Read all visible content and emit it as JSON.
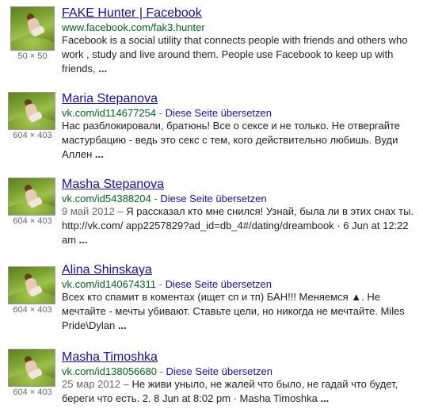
{
  "results": [
    {
      "title": "FAKE Hunter | Facebook",
      "url": "www.facebook.com/fak3.hunter",
      "translate": "",
      "date": "",
      "snippet": "Facebook is a social utility that connects people with friends and others who work , study and live around them. People use Facebook to keep up with friends, ",
      "ellipsis": "...",
      "size": "50 × 50"
    },
    {
      "title": "Maria Stepanova",
      "url": "vk.com/id114677254",
      "separator": " - ",
      "translate": "Diese Seite übersetzen",
      "date": "",
      "snippet": "Нас разблокировали, братюнь! Все о сексе и не только. Не отвергайте мастурбацию - ведь это секс с тем, кого действительно любишь. Вуди Аллен ",
      "ellipsis": "...",
      "size": "604 × 403"
    },
    {
      "title": "Masha Stepanova",
      "url": "vk.com/id54388204",
      "separator": " - ",
      "translate": "Diese Seite übersetzen",
      "date": "9 май 2012 – ",
      "snippet": "Я рассказал кто мне снился! Узнай, была ли в этих снах ты. http://vk.com/ app2257829?ad_id=db_4#/dating/dreambook · 6 Jun at 12:22 am ",
      "ellipsis": "...",
      "size": "604 × 403"
    },
    {
      "title": "Alina Shinskaya",
      "url": "vk.com/id140674311",
      "separator": " - ",
      "translate": "Diese Seite übersetzen",
      "date": "",
      "snippet": "Всех кто спамит в коментах (ищет сп и тп) БАН!!! Меняемся ▲. Не мечтайте - мечты убивают. Ставьте цели, но никогда не мечтайте. Miles Pride\\Dylan ",
      "ellipsis": "...",
      "size": "604 × 403"
    },
    {
      "title": "Masha Timoshka",
      "url": "vk.com/id138056680",
      "separator": " - ",
      "translate": "Diese Seite übersetzen",
      "date": "25 мар 2012 – ",
      "snippet": "Не живи уныло, не жалей что было, не гадай что будет, береги что есть. 2. 8 Jun at 8:02 pm · Masha Timoshka ",
      "ellipsis": "...",
      "size": "604 × 403"
    }
  ]
}
